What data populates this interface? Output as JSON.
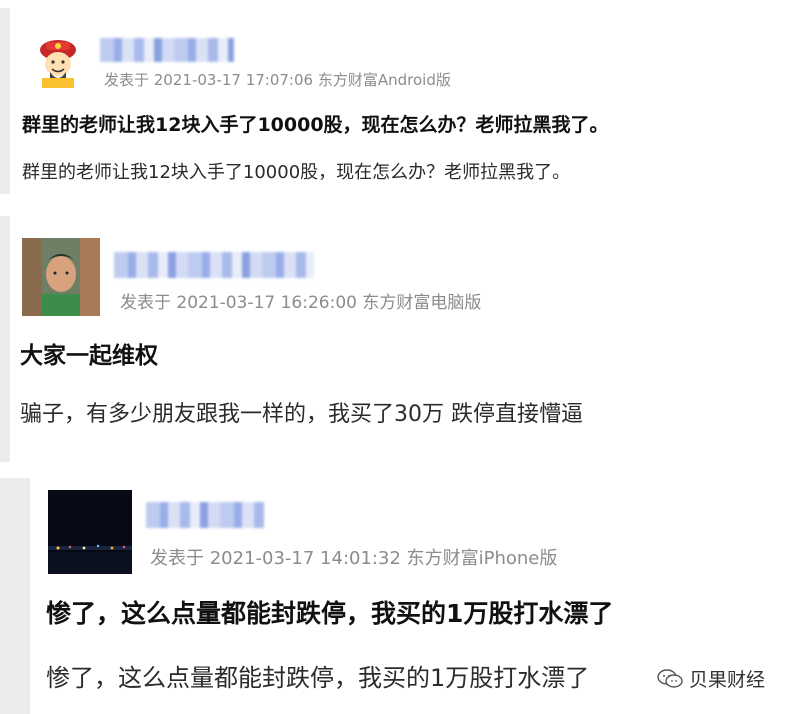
{
  "posts": [
    {
      "meta": "发表于 2021-03-17 17:07:06 东方财富Android版",
      "title": "群里的老师让我12块入手了10000股，现在怎么办？老师拉黑我了。",
      "body": "群里的老师让我12块入手了10000股，现在怎么办？老师拉黑我了。"
    },
    {
      "meta": "发表于 2021-03-17 16:26:00 东方财富电脑版",
      "title": "大家一起维权",
      "body": "骗子，有多少朋友跟我一样的，我买了30万 跌停直接懵逼"
    },
    {
      "meta": "发表于 2021-03-17 14:01:32 东方财富iPhone版",
      "title": "惨了，这么点量都能封跌停，我买的1万股打水漂了",
      "body": "惨了，这么点量都能封跌停，我买的1万股打水漂了"
    }
  ],
  "watermark": {
    "label": "贝果财经",
    "icon": "wechat-icon"
  }
}
